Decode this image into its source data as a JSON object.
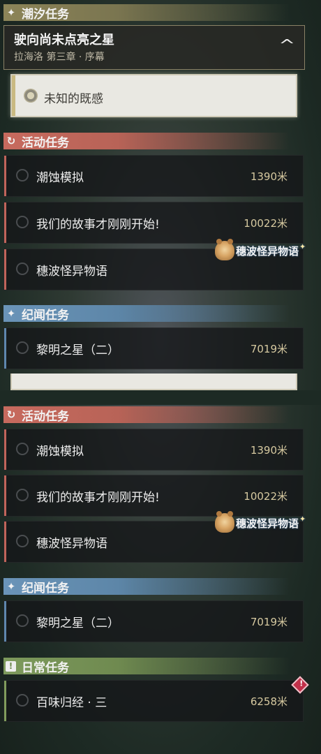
{
  "top": {
    "tide_header": {
      "label": "潮汐任务",
      "icon": "sparkle-icon"
    },
    "main_quest": {
      "title": "驶向尚未点亮之星",
      "subtitle": "拉海洛 第三章 · 序幕",
      "collapse_icon": "chevron-up-icon"
    },
    "sub_task": {
      "label": "未知的既感"
    },
    "event_header": {
      "label": "活动任务",
      "icon": "swirl-icon"
    },
    "event_quests": [
      {
        "title": "潮蚀模拟",
        "distance": "1390米"
      },
      {
        "title": "我们的故事才刚刚开始!",
        "distance": "10022米"
      },
      {
        "title": "穗波怪异物语",
        "distance": ""
      }
    ],
    "badge": {
      "label": "穗波怪异物语"
    },
    "record_header": {
      "label": "纪闻任务",
      "icon": "sparkle-icon"
    },
    "record_quests": [
      {
        "title": "黎明之星（二）",
        "distance": "7019米"
      }
    ]
  },
  "bottom": {
    "event_header": {
      "label": "活动任务",
      "icon": "swirl-icon"
    },
    "event_quests": [
      {
        "title": "潮蚀模拟",
        "distance": "1390米"
      },
      {
        "title": "我们的故事才刚刚开始!",
        "distance": "10022米"
      },
      {
        "title": "穗波怪异物语",
        "distance": ""
      }
    ],
    "badge": {
      "label": "穗波怪异物语"
    },
    "record_header": {
      "label": "纪闻任务",
      "icon": "sparkle-icon"
    },
    "record_quests": [
      {
        "title": "黎明之星（二）",
        "distance": "7019米"
      }
    ],
    "daily_header": {
      "label": "日常任务",
      "icon": "exclamation-icon"
    },
    "daily_quests": [
      {
        "title": "百味归经 · 三",
        "distance": "6258米",
        "alert_icon": "alert-diamond-icon"
      }
    ]
  }
}
